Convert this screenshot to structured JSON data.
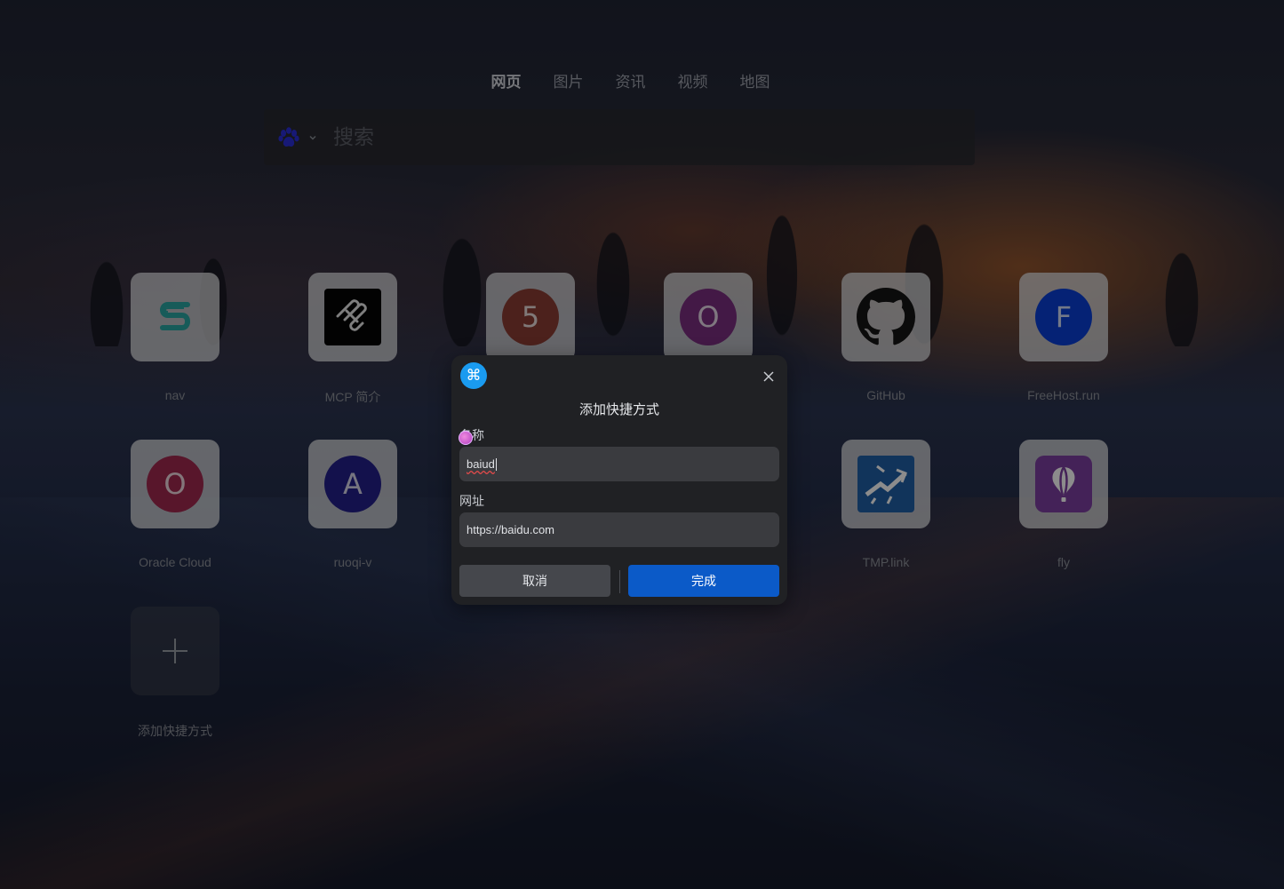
{
  "tabs": [
    "网页",
    "图片",
    "资讯",
    "视频",
    "地图"
  ],
  "active_tab": "网页",
  "search": {
    "placeholder": "搜索",
    "engine_icon": "baidu-paw-icon"
  },
  "shortcuts": [
    {
      "label": "nav",
      "icon": "s-logo-icon"
    },
    {
      "label": "MCP 简介",
      "icon": "mcp-logo-icon"
    },
    {
      "label": "",
      "letter": "5",
      "color": "#8a3d33"
    },
    {
      "label": "",
      "letter": "O",
      "color": "#7a2f80"
    },
    {
      "label": "GitHub",
      "icon": "github-icon"
    },
    {
      "label": "FreeHost.run",
      "letter": "F",
      "color": "#0a3fd6"
    },
    {
      "label": "Oracle Cloud",
      "letter": "O",
      "color": "#a0284f"
    },
    {
      "label": "ruoqi-v",
      "letter": "A",
      "color": "#23208a"
    },
    {
      "label": "TMP.link",
      "icon": "tmplink-icon"
    },
    {
      "label": "fly",
      "icon": "fly-balloon-icon"
    },
    {
      "label": "添加快捷方式",
      "icon": "plus-icon"
    }
  ],
  "dialog": {
    "title": "添加快捷方式",
    "name_label": "名称",
    "name_value": "baiud",
    "url_label": "网址",
    "url_value": "https://baidu.com",
    "cancel": "取消",
    "done": "完成"
  },
  "colors": {
    "accent": "#0b5ac8",
    "logo": "#1a9bf0"
  }
}
